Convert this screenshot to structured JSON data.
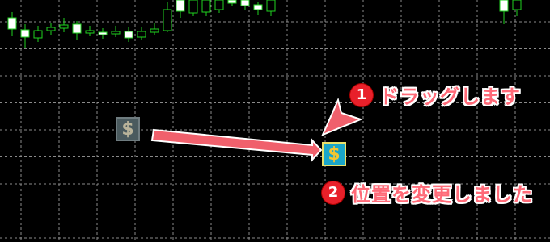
{
  "step1": {
    "number": "1",
    "text": "ドラッグします"
  },
  "step2": {
    "number": "2",
    "text": "位置を変更しました"
  },
  "icon": {
    "name": "dollar-sign-icon",
    "glyph": "$"
  },
  "colors": {
    "grid": "#8a8a8a",
    "candle_outline": "#1fd21f",
    "candle_body": "#ffffff",
    "arrow": "#f0606c",
    "badge": "#e8202a"
  }
}
